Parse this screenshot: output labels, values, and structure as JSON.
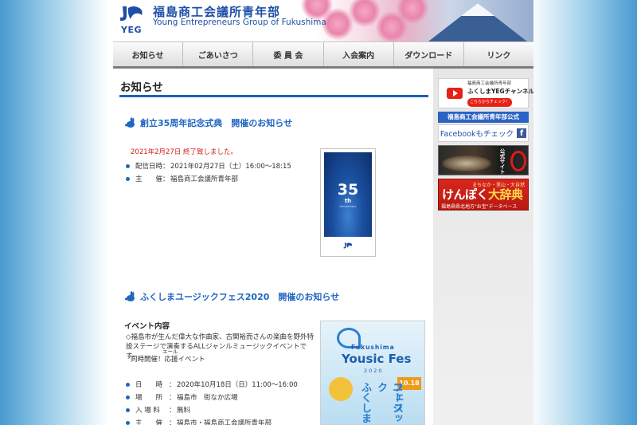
{
  "header": {
    "logo_text": "YEG",
    "title": "福島商工会議所青年部",
    "subtitle": "Young Entrepreneurs Group of Fukushima"
  },
  "nav": [
    {
      "label": "お知らせ"
    },
    {
      "label": "ごあいさつ"
    },
    {
      "label": "委 員 会"
    },
    {
      "label": "入会案内"
    },
    {
      "label": "ダウンロード"
    },
    {
      "label": "リンク"
    }
  ],
  "main": {
    "section_title": "お知らせ",
    "news1": {
      "title": "創立35周年記念式典　開催のお知らせ",
      "status": "2021年2月27日 終了致しました。",
      "rows": [
        {
          "label": "配信日時",
          "value": "2021年02月27日（土）16:00～18:15"
        },
        {
          "label": "主　　催",
          "value": "福島商工会議所青年部"
        }
      ],
      "poster": {
        "number": "35",
        "suffix": "th",
        "sub": "Anniversary"
      }
    },
    "news2": {
      "title": "ふくしまユージックフェス2020　開催のお知らせ",
      "subhead": "イベント内容",
      "description": "◇福島市が生んだ偉大な作曲家、古関裕而さんの楽曲を野外特設ステージで演奏するALLジャンルミュージックイベントです。",
      "ruby_text": "同時開催！応援イベント",
      "ruby_reading": "エール",
      "rows": [
        {
          "label": "日　　時",
          "value": "2020年10月18日（日）11:00～16:00"
        },
        {
          "label": "場　　所",
          "value": "福島市　街なか広場"
        },
        {
          "label": "入 場 料",
          "value": "無料"
        },
        {
          "label": "主　　催",
          "value": "福島市・福島商工会議所青年部"
        }
      ],
      "poster": {
        "small": "Fukushima",
        "title": "Yousic Fes",
        "year": "2020",
        "date": "10.18",
        "v1": "ふくしま",
        "v2": "ユージック",
        "v3": "フェス"
      }
    }
  },
  "sidebar": {
    "youtube": {
      "line1": "福島商工会議所青年部",
      "line2": "ふくしまYEGチャンネル",
      "line3": "こちらからチェック！"
    },
    "facebook_head": "福島商工会議所青年部公式",
    "facebook_label": "Facebookもチェック",
    "banner_dark_text": "公式サイト",
    "ken": {
      "small": "まちなか・里山・大自然",
      "big_a": "けんぽく",
      "big_b": "大辞典",
      "bottom": "福島県県北地方\"お宝\"データベース"
    }
  },
  "colors": {
    "accent": "#1b5fbd",
    "heading_blue": "#1f66c2",
    "alert_red": "#d0201b"
  }
}
